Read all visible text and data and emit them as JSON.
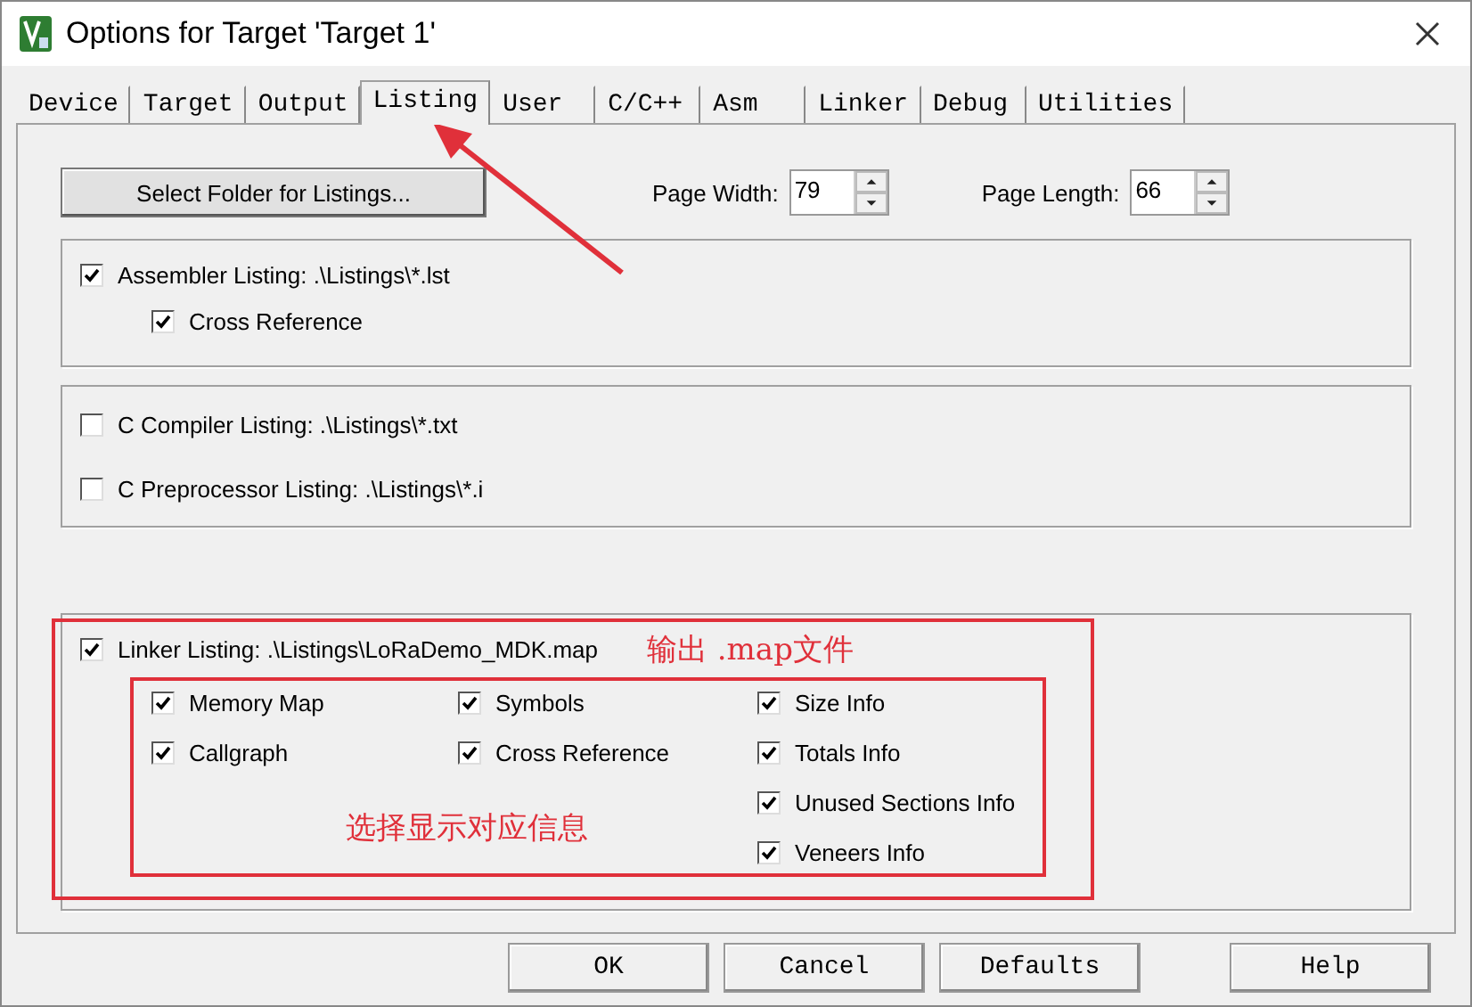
{
  "window": {
    "title": "Options for Target 'Target 1'"
  },
  "tabs": [
    {
      "label": "Device",
      "selected": false
    },
    {
      "label": "Target",
      "selected": false
    },
    {
      "label": "Output",
      "selected": false
    },
    {
      "label": "Listing",
      "selected": true
    },
    {
      "label": "User",
      "selected": false
    },
    {
      "label": "C/C++",
      "selected": false
    },
    {
      "label": "Asm",
      "selected": false
    },
    {
      "label": "Linker",
      "selected": false
    },
    {
      "label": "Debug",
      "selected": false
    },
    {
      "label": "Utilities",
      "selected": false
    }
  ],
  "folder_button": "Select Folder for Listings...",
  "spinners": [
    {
      "label": "Page Width:",
      "value": "79"
    },
    {
      "label": "Page Length:",
      "value": "66"
    }
  ],
  "assembler": {
    "main": {
      "label": "Assembler Listing:  .\\Listings\\*.lst",
      "checked": true
    },
    "sub": {
      "label": "Cross Reference",
      "checked": true
    }
  },
  "compiler": [
    {
      "label": "C Compiler Listing:  .\\Listings\\*.txt",
      "checked": false
    },
    {
      "label": "C Preprocessor Listing:  .\\Listings\\*.i",
      "checked": false
    }
  ],
  "linker": {
    "main": {
      "label": "Linker Listing:  .\\Listings\\LoRaDemo_MDK.map",
      "checked": true
    },
    "columns": [
      [
        {
          "label": "Memory Map",
          "checked": true
        },
        {
          "label": "Callgraph",
          "checked": true
        }
      ],
      [
        {
          "label": "Symbols",
          "checked": true
        },
        {
          "label": "Cross Reference",
          "checked": true
        }
      ],
      [
        {
          "label": "Size Info",
          "checked": true
        },
        {
          "label": "Totals Info",
          "checked": true
        },
        {
          "label": "Unused Sections Info",
          "checked": true
        },
        {
          "label": "Veneers Info",
          "checked": true
        }
      ]
    ]
  },
  "annotations": [
    "输出 .map文件",
    "选择显示对应信息"
  ],
  "buttons": [
    "OK",
    "Cancel",
    "Defaults",
    "Help"
  ]
}
